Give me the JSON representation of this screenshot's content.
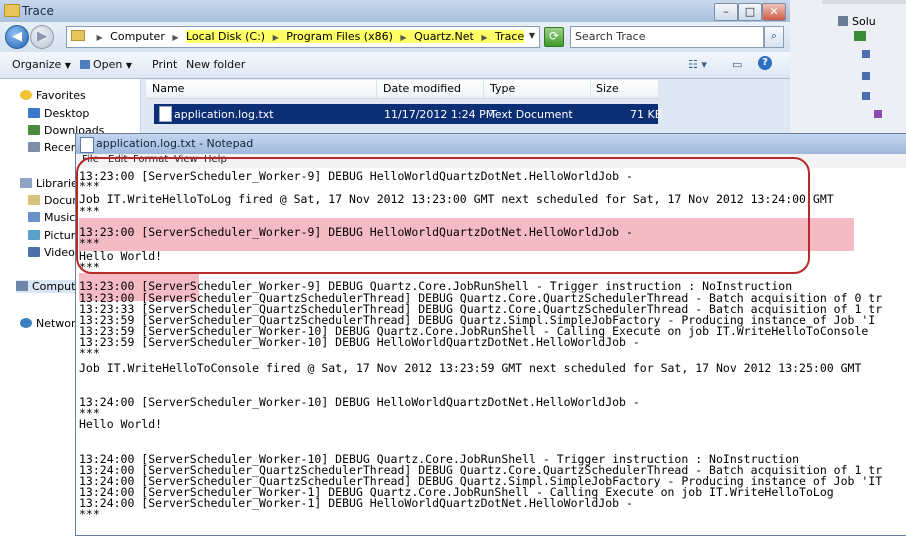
{
  "explorer": {
    "title": "Trace",
    "address": {
      "crumbs": [
        "Computer",
        "Local Disk (C:)",
        "Program Files (x86)",
        "Quartz.Net",
        "Trace"
      ]
    },
    "search_placeholder": "Search Trace",
    "toolbar": {
      "organize": "Organize",
      "open": "Open",
      "print": "Print",
      "new_folder": "New folder"
    },
    "nav": {
      "favorites": "Favorites",
      "desktop": "Desktop",
      "downloads": "Downloads",
      "recent": "Recent",
      "libraries": "Libraries",
      "documents": "Docum",
      "music": "Music",
      "pictures": "Picture",
      "videos": "Videos",
      "computer": "Compute",
      "network": "Network"
    },
    "columns": {
      "name": "Name",
      "date": "Date modified",
      "type": "Type",
      "size": "Size"
    },
    "files": [
      {
        "name": "application.log.txt",
        "date": "11/17/2012 1:24 PM",
        "type": "Text Document",
        "size": "71 KB"
      }
    ]
  },
  "right_panel": {
    "item": "Solu"
  },
  "notepad": {
    "title": "application.log.txt - Notepad",
    "menu": [
      "File",
      "Edit",
      "Format",
      "View",
      "Help"
    ],
    "lines": [
      "13:23:00 [ServerScheduler_Worker-9] DEBUG HelloWorldQuartzDotNet.HelloWorldJob -",
      "***",
      "Job IT.WriteHelloToLog fired @ Sat, 17 Nov 2012 13:23:00 GMT next scheduled for Sat, 17 Nov 2012 13:24:00 GMT",
      "***",
      "13:23:00 [ServerScheduler_Worker-9] DEBUG HelloWorldQuartzDotNet.HelloWorldJob -",
      "***",
      "Hello World!",
      "***",
      "13:23:00 [ServerScheduler_Worker-9] DEBUG Quartz.Core.JobRunShell - Trigger instruction : NoInstruction",
      "13:23:00 [ServerScheduler_QuartzSchedulerThread] DEBUG Quartz.Core.QuartzSchedulerThread - Batch acquisition of 0 tr",
      "13:23:33 [ServerScheduler_QuartzSchedulerThread] DEBUG Quartz.Core.QuartzSchedulerThread - Batch acquisition of 1 tr",
      "13:23:59 [ServerScheduler_QuartzSchedulerThread] DEBUG Quartz.Simpl.SimpleJobFactory - Producing instance of Job 'I",
      "13:23:59 [ServerScheduler_Worker-10] DEBUG Quartz.Core.JobRunShell - Calling Execute on job IT.WriteHelloToConsole",
      "13:23:59 [ServerScheduler_Worker-10] DEBUG HelloWorldQuartzDotNet.HelloWorldJob -",
      "***",
      "Job IT.WriteHelloToConsole fired @ Sat, 17 Nov 2012 13:23:59 GMT next scheduled for Sat, 17 Nov 2012 13:25:00 GMT",
      "",
      "13:24:00 [ServerScheduler_Worker-10] DEBUG HelloWorldQuartzDotNet.HelloWorldJob -",
      "***",
      "Hello World!",
      "",
      "13:24:00 [ServerScheduler_Worker-10] DEBUG Quartz.Core.JobRunShell - Trigger instruction : NoInstruction",
      "13:24:00 [ServerScheduler_QuartzSchedulerThread] DEBUG Quartz.Core.QuartzSchedulerThread - Batch acquisition of 1 tr",
      "13:24:00 [ServerScheduler_QuartzSchedulerThread] DEBUG Quartz.Simpl.SimpleJobFactory - Producing instance of Job 'IT",
      "13:24:00 [ServerScheduler_Worker-1] DEBUG Quartz.Core.JobRunShell - Calling Execute on job IT.WriteHelloToLog",
      "13:24:00 [ServerScheduler_Worker-1] DEBUG HelloWorldQuartzDotNet.HelloWorldJob -",
      "***"
    ]
  },
  "colors": {
    "highlight_yellow": "#ffff66",
    "highlight_pink": "#f2aab5",
    "annotation_red": "#b82a2a",
    "selection_blue": "#0c2e75"
  }
}
